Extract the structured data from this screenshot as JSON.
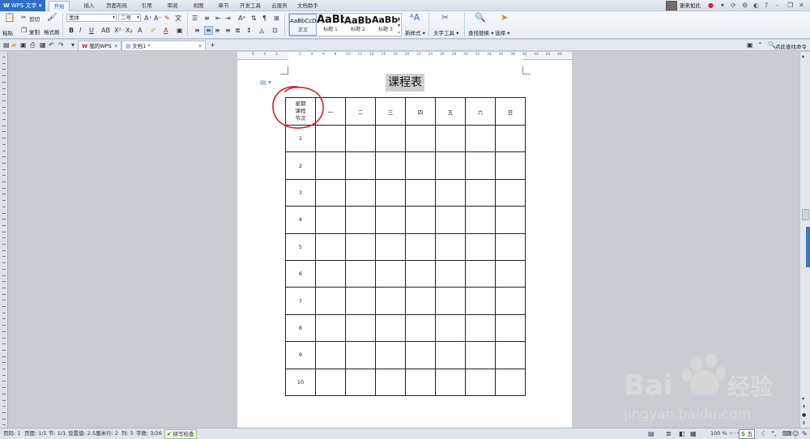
{
  "app": {
    "name": "WPS 文字"
  },
  "menu": {
    "tabs": [
      "开始",
      "插入",
      "页面布局",
      "引用",
      "审阅",
      "视图",
      "章节",
      "开发工具",
      "云服务",
      "文档助手"
    ],
    "active": "开始"
  },
  "user": {
    "name": "谢来如此"
  },
  "ribbon": {
    "clipboard": {
      "paste": "粘贴",
      "cut": "剪切",
      "copy": "复制",
      "format_painter": "格式刷"
    },
    "font": {
      "family": "黑体",
      "size": "二号"
    },
    "styles": [
      {
        "preview": "AaBbCcDd",
        "label": "正文"
      },
      {
        "preview": "AaBb",
        "label": "标题 1"
      },
      {
        "preview": "AaBb(",
        "label": "标题 2"
      },
      {
        "preview": "AaBbC",
        "label": "标题 3"
      }
    ],
    "new_style": "新样式",
    "text_tools": "文字工具",
    "find_replace": "查找替换",
    "select": "选择"
  },
  "tabs": {
    "items": [
      {
        "label": "我的WPS",
        "active": false
      },
      {
        "label": "文档1 *",
        "active": true
      }
    ],
    "search_label": "点此查找命令"
  },
  "ruler": {
    "labels": [
      "6",
      "4",
      "2",
      "",
      "2",
      "4",
      "6",
      "8",
      "10",
      "12",
      "14",
      "16",
      "18",
      "20",
      "22",
      "24",
      "26",
      "28",
      "30",
      "32",
      "34",
      "36",
      "38",
      "40",
      "42",
      "44",
      "46"
    ]
  },
  "document": {
    "title": "课程表",
    "header_corner": [
      "星期",
      "课程",
      "节次"
    ],
    "days": [
      "一",
      "二",
      "三",
      "四",
      "五",
      "六",
      "日"
    ],
    "periods": [
      "1",
      "2",
      "3",
      "4",
      "5",
      "6",
      "7",
      "8",
      "9",
      "10"
    ]
  },
  "status": {
    "page": "页码: 1",
    "pages": "页面: 1/1",
    "section": "节: 1/1",
    "position": "设置值: 2.5厘米",
    "row": "行: 2",
    "col": "列: 5",
    "words": "字数: 3/26",
    "spell": "拼写检查",
    "zoom": "100 %"
  },
  "watermark": {
    "brand": "Bai",
    "brand2": "经验",
    "url": "jingyan.baidu.com"
  },
  "ime": {
    "label": "五"
  },
  "colors": {
    "accent": "#2f6fc6",
    "annotation": "#d8202a"
  }
}
